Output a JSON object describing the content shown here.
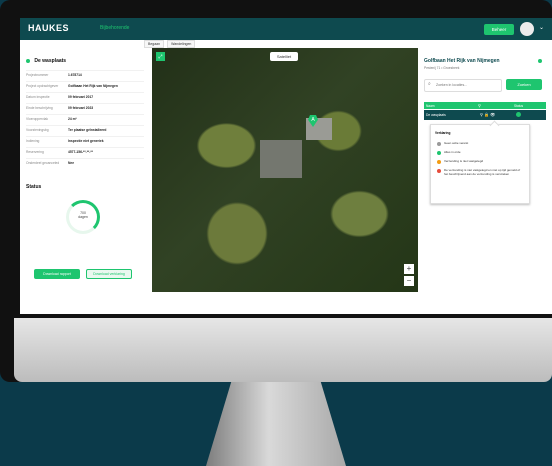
{
  "header": {
    "logo_text": "HAUKES",
    "nav_active": "Bijbehorende",
    "top_button": "Beheer",
    "avatar_caret": "⌄"
  },
  "tabs": [
    {
      "label": "Begaan"
    },
    {
      "label": "Wandelingen"
    }
  ],
  "left_panel": {
    "title": "De wasplaats",
    "fields": [
      {
        "label": "Projectnummer",
        "value": "1.678714"
      },
      {
        "label": "Project opdrachtgever",
        "value": "Golfbaan Het Rijk van Nijmegen"
      },
      {
        "label": "Datum inspectie",
        "value": "09 februari 2017"
      },
      {
        "label": "Einde beschrijving",
        "value": "09 februari 2023"
      },
      {
        "label": "Vloeroppervlak",
        "value": "24 m²"
      },
      {
        "label": "Voorzieningsbg",
        "value": "Ter plaatse geïnstalleerd"
      },
      {
        "label": "Indiening",
        "value": "Inspectie niet generiek"
      },
      {
        "label": "Reservering",
        "value": "4577-156-**-**-**"
      },
      {
        "label": "Onderdeel gecanceled",
        "value": "Nee"
      }
    ],
    "status_title": "Status",
    "status_value": "700",
    "status_unit": "dagen",
    "download_report": "Download rapport",
    "download_checklist": "Download verklaring"
  },
  "map": {
    "type_label": "Satelliet",
    "expand_icon": "⤢",
    "marker_label": "A",
    "zoom_in": "+",
    "zoom_out": "−"
  },
  "right_panel": {
    "title": "Golfbaan Het Rijk van Nijmegen",
    "subtitle": "Pestenij 71 • Groesbeek",
    "search_placeholder": "Zoeken in locaties...",
    "search_button": "Zoeken",
    "table": {
      "headers": [
        "Naam",
        "",
        "Status"
      ],
      "rows": [
        {
          "name": "De wasplaats",
          "icons": "⚲ 🔒 👁"
        }
      ]
    },
    "legend": {
      "title": "Verklaring",
      "items": [
        {
          "color": "#9a9a9a",
          "text": "Geen actie vereist"
        },
        {
          "color": "#1ec56f",
          "text": "Alles in orde"
        },
        {
          "color": "#f39c12",
          "text": "Verzending is niet vastgelegd"
        },
        {
          "color": "#e74c3c",
          "text": "De verzending is niet vastgelegd en niet op tijd gemeld of het beschrijvend aan de verzending is verstreken"
        }
      ]
    }
  }
}
